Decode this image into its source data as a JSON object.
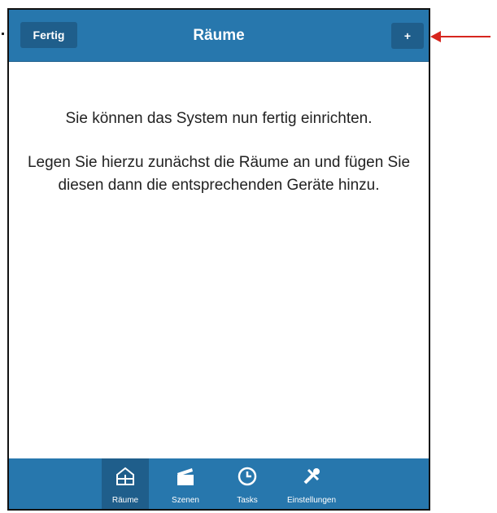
{
  "navbar": {
    "back_label": "Fertig",
    "title": "Räume",
    "add_label": "+"
  },
  "content": {
    "message_1": "Sie können das System nun fertig einrichten.",
    "message_2": "Legen Sie hierzu zunächst die Räume an und fügen Sie diesen dann die entsprechenden Geräte hinzu."
  },
  "tabbar": {
    "tabs": [
      {
        "label": "Räume",
        "icon": "rooms-icon",
        "active": true
      },
      {
        "label": "Szenen",
        "icon": "clapperboard-icon",
        "active": false
      },
      {
        "label": "Tasks",
        "icon": "clock-icon",
        "active": false
      },
      {
        "label": "Einstellungen",
        "icon": "tools-icon",
        "active": false
      }
    ]
  },
  "colors": {
    "accent": "#2777ad",
    "accent_dark": "#1f5e8b",
    "annotation_arrow": "#d7261e"
  }
}
